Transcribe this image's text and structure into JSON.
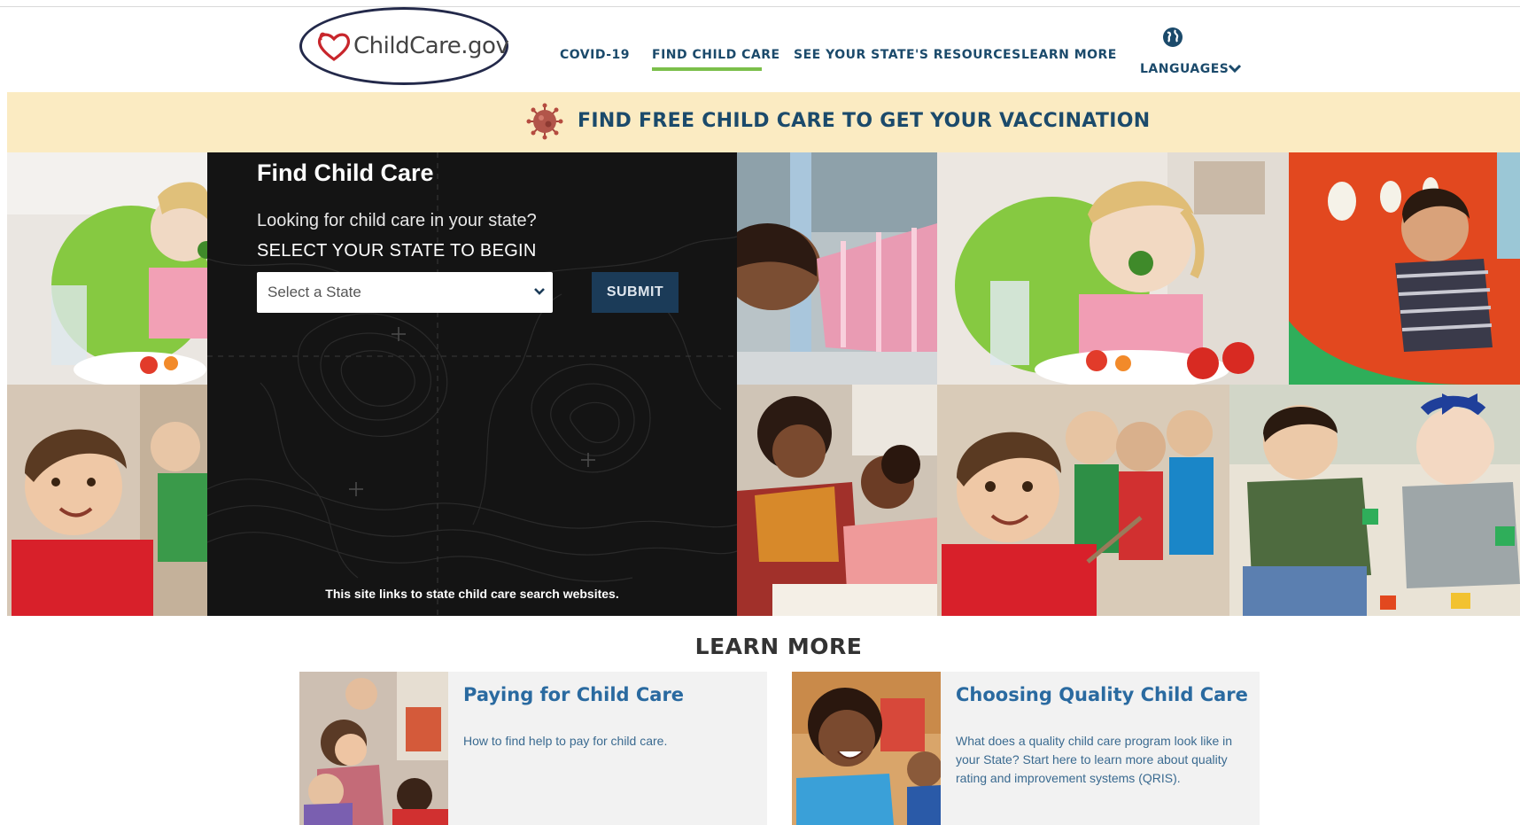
{
  "header": {
    "logo_text": "ChildCare.gov",
    "nav": {
      "covid": "COVID-19",
      "find": "FIND CHILD CARE",
      "state": "SEE YOUR STATE'S RESOURCES",
      "learn": "LEARN MORE",
      "languages": "LANGUAGES"
    },
    "active_item": "FIND CHILD CARE",
    "accent_color": "#7bbf4a"
  },
  "banner": {
    "text": "FIND FREE CHILD CARE TO GET YOUR VACCINATION",
    "background": "#fbebc2"
  },
  "find_panel": {
    "title": "Find Child Care",
    "subtitle": "Looking for child care in your state?",
    "select_label": "SELECT YOUR STATE TO BEGIN",
    "select_value": "Select a State",
    "submit_label": "SUBMIT",
    "note": "This site links to state child care search websites."
  },
  "learn_more": {
    "title": "LEARN MORE",
    "cards": [
      {
        "title": "Paying for Child Care",
        "description": "How to find help to pay for child care."
      },
      {
        "title": "Choosing Quality Child Care",
        "description": "What does a quality child care program look like in your State? Start here to learn more about quality rating and improvement systems (QRIS)."
      }
    ]
  },
  "icons": [
    "heart-logo-icon",
    "globe-icon",
    "chevron-down-icon",
    "virus-icon"
  ]
}
